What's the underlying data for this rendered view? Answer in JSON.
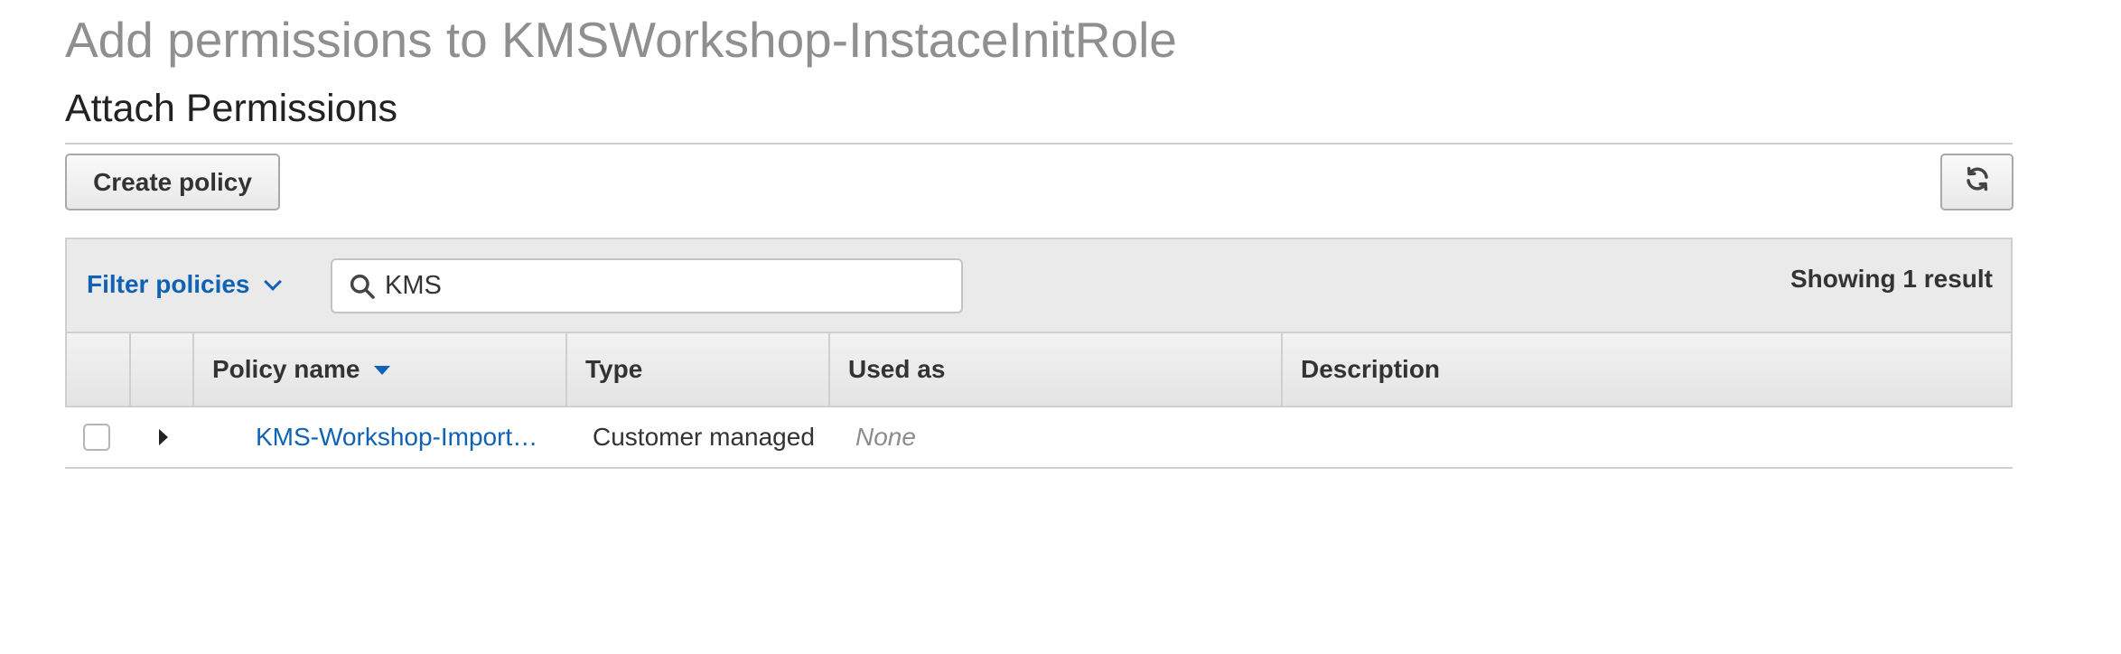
{
  "page": {
    "title": "Add permissions to KMSWorkshop-InstaceInitRole"
  },
  "section": {
    "title": "Attach Permissions"
  },
  "toolbar": {
    "create_policy_label": "Create policy",
    "refresh_icon": "refresh-icon"
  },
  "filter": {
    "toggle_label": "Filter policies",
    "toggle_icon": "chevron-down-icon",
    "search_value": "KMS",
    "search_icon": "search-icon",
    "result_count": "Showing 1 result"
  },
  "table": {
    "columns": [
      {
        "label": ""
      },
      {
        "label": ""
      },
      {
        "label": "Policy name",
        "sorted": "descending"
      },
      {
        "label": "Type"
      },
      {
        "label": "Used as"
      },
      {
        "label": "Description"
      }
    ],
    "rows": [
      {
        "checked": false,
        "policy_name": "KMS-Workshop-Import…",
        "type": "Customer managed",
        "used_as": "None",
        "description": ""
      }
    ]
  },
  "colors": {
    "link": "#0f62b4",
    "title_gray": "#8f8f8f",
    "header_bg": "#eaeaea",
    "border": "#cfcfcf"
  }
}
